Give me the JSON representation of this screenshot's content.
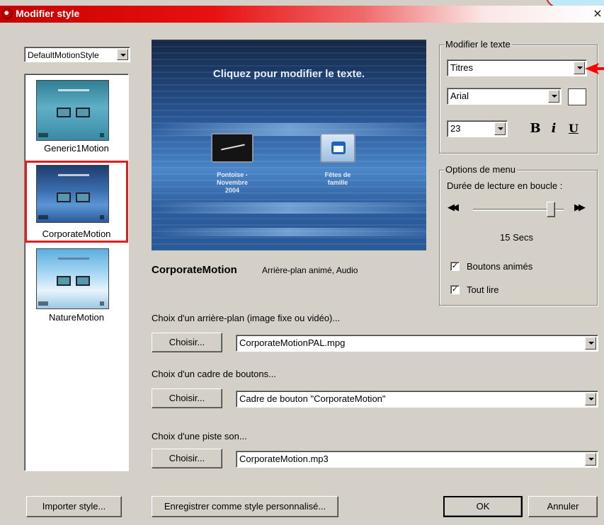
{
  "window": {
    "title": "Modifier style",
    "close_glyph": "×"
  },
  "style_selector": {
    "value": "DefaultMotionStyle"
  },
  "styles": [
    {
      "label": "Generic1Motion"
    },
    {
      "label": "CorporateMotion",
      "selected": true
    },
    {
      "label": "NatureMotion"
    }
  ],
  "preview": {
    "cta": "Cliquez pour modifier le texte.",
    "button1_caption": "Pontoise -\nNovembre\n2004",
    "button2_caption": "Fêtes de\nfamille"
  },
  "style_info": {
    "name": "CorporateMotion",
    "description": "Arrière-plan animé, Audio"
  },
  "modify_text": {
    "legend": "Modifier le texte",
    "element_value": "Titres",
    "font_value": "Arial",
    "size_value": "23",
    "bold_label": "B",
    "italic_label": "i",
    "underline_label": "U"
  },
  "menu_options": {
    "legend": "Options de menu",
    "loop_label": "Durée de lecture en boucle :",
    "rewind_glyph": "◀◀",
    "forward_glyph": "▶▶",
    "loop_value": "15 Secs",
    "slider_level": 0.9,
    "animated_buttons_label": "Boutons animés",
    "animated_buttons_checked": true,
    "play_all_label": "Tout lire",
    "play_all_checked": true,
    "check_glyph": "✓"
  },
  "background": {
    "label": "Choix d'un arrière-plan (image fixe ou vidéo)...",
    "button": "Choisir...",
    "value": "CorporateMotionPAL.mpg"
  },
  "button_frame": {
    "label": "Choix d'un cadre de boutons...",
    "button": "Choisir...",
    "value": "Cadre de bouton \"CorporateMotion\""
  },
  "sound_track": {
    "label": "Choix d'une piste son...",
    "button": "Choisir...",
    "value": "CorporateMotion.mp3"
  },
  "footer": {
    "import_button": "Importer style...",
    "save_button": "Enregistrer comme style personnalisé...",
    "ok_button": "OK",
    "cancel_button": "Annuler"
  },
  "colors": {
    "titlebar": "#e81010",
    "selection_border": "#dd1f1f",
    "annotation_arrow": "#ff0000"
  }
}
